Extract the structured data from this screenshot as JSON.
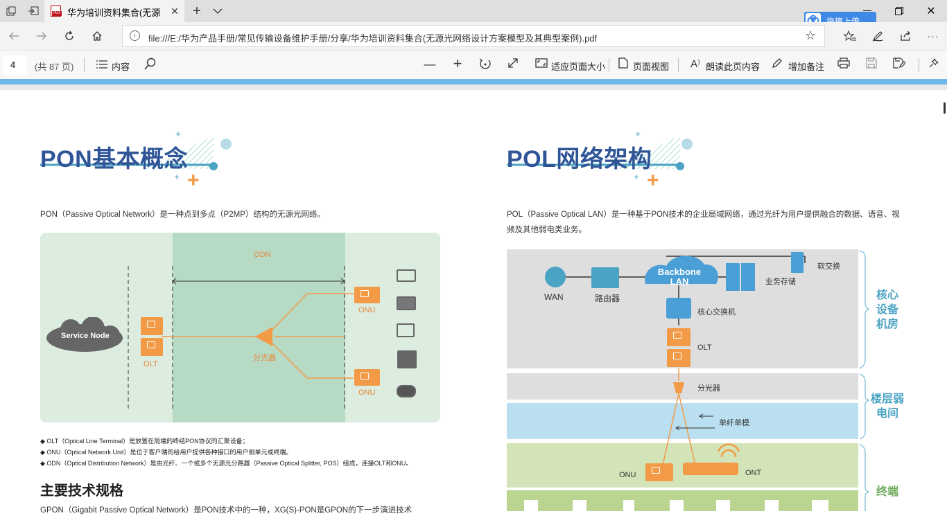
{
  "browser": {
    "tab_title": "华为培训资料集合(无源",
    "url": "file:///E:/华为产品手册/常见传输设备维护手册/分享/华为培训资料集合(无源光网络设计方案模型及其典型案例).pdf",
    "cloud_button": "拖拽上传"
  },
  "pdf_toolbar": {
    "page_number": "4",
    "page_total": "(共 87 页)",
    "contents_label": "内容",
    "fit_page_label": "适应页面大小",
    "page_view_label": "页面视图",
    "read_aloud_label": "朗读此页内容",
    "add_notes_label": "增加备注"
  },
  "left_page": {
    "heading": "PON基本概念",
    "intro": "PON（Passive Optical Network）是一种点到多点（P2MP）结构的无源光网络。",
    "diagram": {
      "odn_label": "ODN",
      "service_node": "Service Node",
      "olt": "OLT",
      "splitter": "分光器",
      "onu_top": "ONU",
      "onu_bottom": "ONU"
    },
    "notes": [
      "◆ OLT（Optical Line Terminal）是放置在局端的终结PON协议的汇聚设备；",
      "◆ ONU（Optical Network Unit）是位于客户端的给用户提供各种接口的用户侧单元或终端。",
      "◆ ODN（Optical Distribution Network）是由光纤、一个或多个无源光分路器（Passive Optical Splitter, POS）组成，连接OLT和ONU。"
    ],
    "subheading": "主要技术规格",
    "cut_text": "GPON（Gigabit Passive Optical Network）是PON技术中的一种，XG(S)-PON是GPON的下一步演进技术"
  },
  "right_page": {
    "heading": "POL网络架构",
    "intro_line1": "POL（Passive Optical LAN）是一种基于PON技术的企业局域网络，通过光纤为用户提供融合的数据、语音、视",
    "intro_line2": "频及其他弱电类业务。",
    "diagram": {
      "wan": "WAN",
      "router": "路由器",
      "backbone": "Backbone LAN",
      "storage": "业务存储",
      "softswitch": "软交换",
      "core_switch": "核心交换机",
      "olt": "OLT",
      "splitter": "分光器",
      "fiber": "单纤单模",
      "onu": "ONU",
      "ont": "ONT",
      "zone_core": "核心设备机房",
      "zone_floor": "楼层弱电间",
      "zone_terminal": "终端"
    }
  }
}
